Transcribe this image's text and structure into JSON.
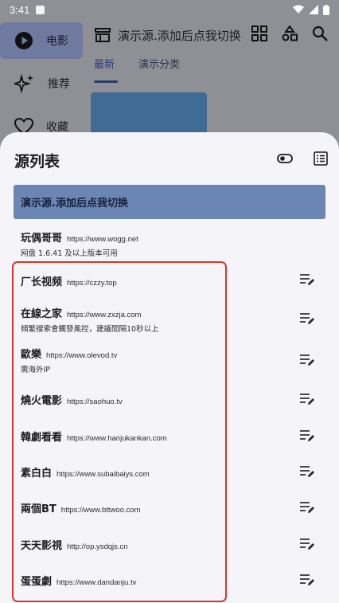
{
  "status_bar": {
    "time": "3:41"
  },
  "nav_rail": {
    "items": [
      {
        "label": "电影",
        "icon": "play-circle-icon",
        "active": true
      },
      {
        "label": "推荐",
        "icon": "sparkle-icon",
        "active": false
      },
      {
        "label": "收藏",
        "icon": "heart-icon",
        "active": false
      }
    ]
  },
  "top_bar": {
    "title": "演示源.添加后点我切换",
    "icons": [
      "grid-icon",
      "shapes-icon",
      "search-icon"
    ]
  },
  "tabs": [
    {
      "label": "最新",
      "active": true
    },
    {
      "label": "演示分类",
      "active": false
    }
  ],
  "sheet": {
    "title": "源列表",
    "selected_source": "演示源.添加后点我切换",
    "sources": [
      {
        "name": "玩偶哥哥",
        "url": "https://www.wogg.net",
        "note": "网盘 1.6.41 及以上版本可用",
        "editable": false
      },
      {
        "name": "厂长视频",
        "url": "https://czzy.top",
        "note": "",
        "editable": true
      },
      {
        "name": "在線之家",
        "url": "https://www.zxzja.com",
        "note": "頻繁搜索會觸發風控，建議間隔10秒以上",
        "editable": true
      },
      {
        "name": "歐樂",
        "url": "https://www.olevod.tv",
        "note": "需海外IP",
        "editable": true
      },
      {
        "name": "燒火電影",
        "url": "https://saohuo.tv",
        "note": "",
        "editable": true
      },
      {
        "name": "韓劇看看",
        "url": "https://www.hanjukankan.com",
        "note": "",
        "editable": true
      },
      {
        "name": "素白白",
        "url": "https://www.subaibaiys.com",
        "note": "",
        "editable": true
      },
      {
        "name": "兩個BT",
        "url": "https://www.bttwoo.com",
        "note": "",
        "editable": true
      },
      {
        "name": "天天影視",
        "url": "http://op.ysdqjs.cn",
        "note": "",
        "editable": true
      },
      {
        "name": "蛋蛋劇",
        "url": "https://www.dandanju.tv",
        "note": "",
        "editable": true
      }
    ]
  },
  "colors": {
    "scrim": "#8f9096",
    "sheet_bg": "#f4f4f9",
    "selected_bg": "#6b86b3",
    "highlight_border": "#d8362b"
  }
}
